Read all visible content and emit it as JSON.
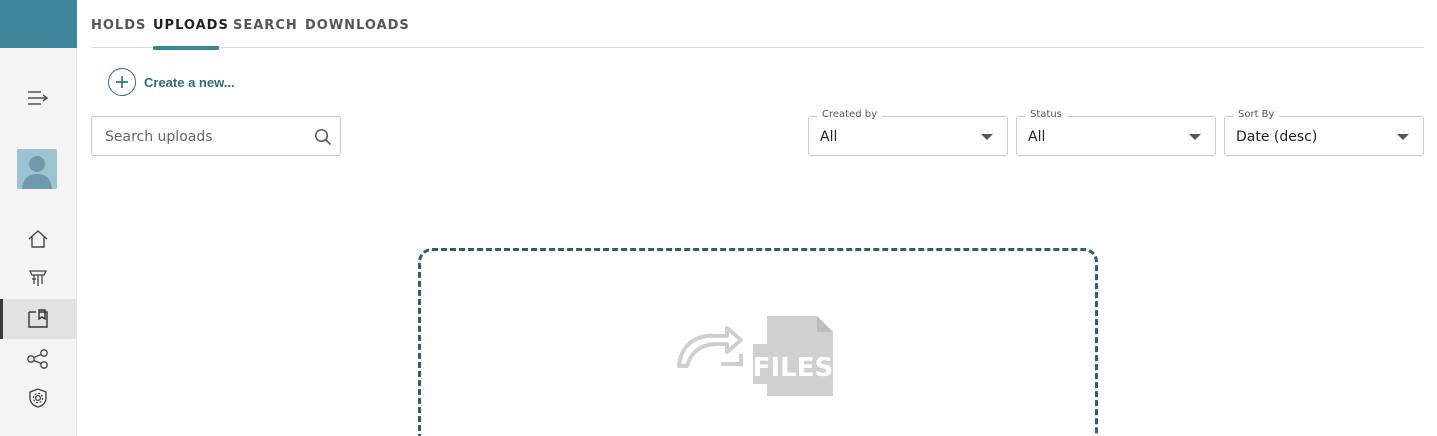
{
  "sidebar": {
    "brand_color": "#3f859a",
    "items": [
      {
        "icon": "menu-expand-icon"
      },
      {
        "icon": "avatar"
      },
      {
        "icon": "home-icon"
      },
      {
        "icon": "holds-icon"
      },
      {
        "icon": "uploads-icon",
        "active": true
      },
      {
        "icon": "share-icon"
      },
      {
        "icon": "shield-settings-icon"
      }
    ]
  },
  "tabs": [
    {
      "label": "HOLDS"
    },
    {
      "label": "UPLOADS",
      "active": true
    },
    {
      "label": "SEARCH"
    },
    {
      "label": "DOWNLOADS"
    }
  ],
  "create": {
    "label": "Create a new..."
  },
  "search": {
    "placeholder": "Search uploads",
    "value": ""
  },
  "filters": {
    "created_by": {
      "label": "Created by",
      "value": "All"
    },
    "status": {
      "label": "Status",
      "value": "All"
    },
    "sort_by": {
      "label": "Sort By",
      "value": "Date (desc)"
    }
  },
  "dropzone": {
    "icon_text": "FILES"
  },
  "colors": {
    "accent": "#3f859a",
    "link": "#2f6b7d",
    "dropzone_border": "#2f5e6c"
  }
}
